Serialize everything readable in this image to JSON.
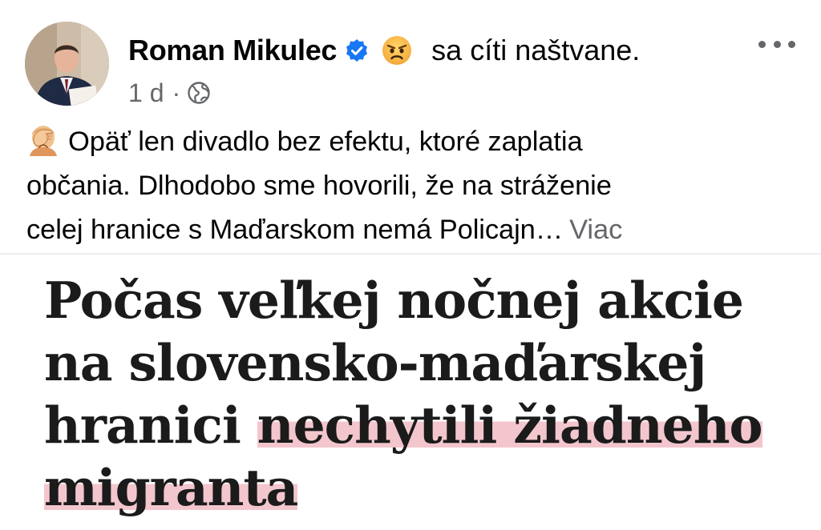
{
  "post": {
    "author_name": "Roman Mikulec",
    "feeling_text": "sa cíti naštvane.",
    "time": "1 d",
    "meta_separator": "·",
    "text_lines": [
      "Opäť len divadlo bez efektu, ktoré zaplatia",
      "občania. Dlhodobo sme hovorili, že na stráženie",
      "celej hranice s Maďarskom nemá Policajn…"
    ],
    "see_more_label": "Viac"
  },
  "icons": {
    "avatar": "avatar-photo",
    "verified": "verified-badge-icon",
    "feeling": "angry-face-icon",
    "more": "more-horizontal-icon",
    "audience": "globe-icon",
    "leading_emoji": "facepalm-emoji-icon"
  },
  "colors": {
    "verified_blue": "#1877f2",
    "secondary_text": "#65676b",
    "highlight_pink": "#f3c6cd",
    "headline_text": "#1b1b1b"
  },
  "article": {
    "headline_line1": "Počas veľkej nočnej akcie",
    "headline_line2": "na slovensko-maďarskej",
    "headline_line3_plain": "hranici ",
    "headline_line3_highlight": "nechytili žiadneho",
    "headline_line4_highlight": "migranta"
  }
}
